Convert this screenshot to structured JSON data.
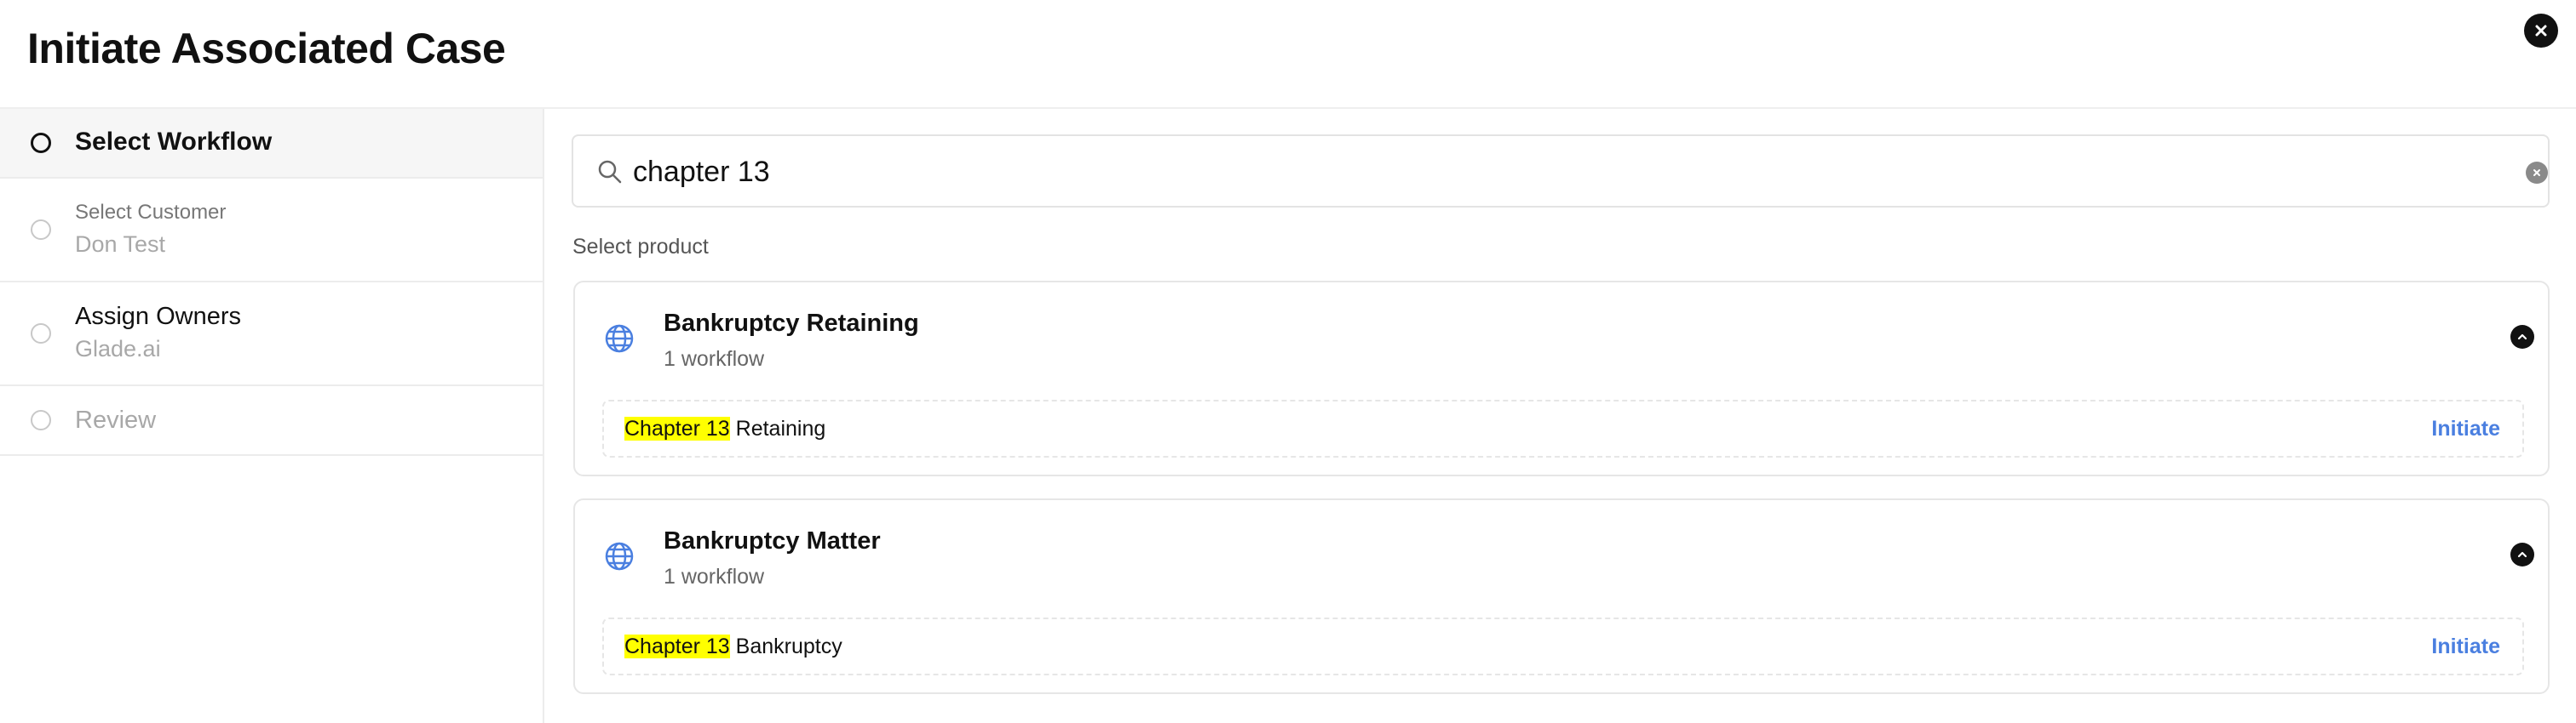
{
  "modal": {
    "title": "Initiate Associated Case"
  },
  "steps": [
    {
      "title": "Select Workflow",
      "subtitle": ""
    },
    {
      "title": "Select Customer",
      "subtitle": "Don Test"
    },
    {
      "title": "Assign Owners",
      "subtitle": "Glade.ai"
    },
    {
      "title": "Review",
      "subtitle": ""
    }
  ],
  "search": {
    "value": "chapter 13",
    "placeholder": ""
  },
  "products_label": "Select product",
  "products": [
    {
      "name": "Bankruptcy Retaining",
      "count": "1 workflow",
      "workflows": [
        {
          "match": "Chapter 13",
          "rest": " Retaining",
          "action": "Initiate"
        }
      ]
    },
    {
      "name": "Bankruptcy Matter",
      "count": "1 workflow",
      "workflows": [
        {
          "match": "Chapter 13",
          "rest": " Bankruptcy",
          "action": "Initiate"
        }
      ]
    }
  ],
  "colors": {
    "accent": "#4a7fe0",
    "highlight": "#ffff00",
    "globe": "#4a7fe0",
    "active_step_bg": "#f6f6f6"
  },
  "icons": {
    "close": "close-icon",
    "search": "search-icon",
    "clear": "clear-icon",
    "globe": "globe-icon",
    "chevron": "chevron-up-icon"
  }
}
